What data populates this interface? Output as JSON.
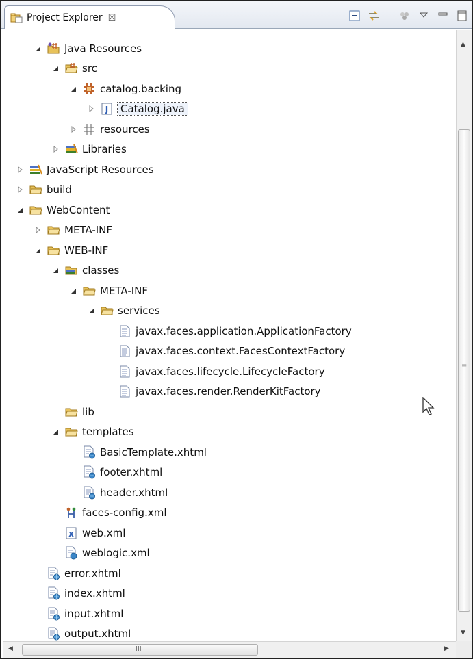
{
  "panel": {
    "tab_label": "Project Explorer",
    "tab_close": "☒"
  },
  "toolbar": {
    "items": [
      "collapse-all",
      "link-with-editor",
      "select-working-set",
      "view-menu",
      "minimize",
      "maximize"
    ]
  },
  "tree": [
    {
      "label": "Java Resources",
      "icon": "java-resources-icon",
      "level": 2,
      "expanded": true
    },
    {
      "label": "src",
      "icon": "source-folder-icon",
      "level": 3,
      "expanded": true
    },
    {
      "label": "catalog.backing",
      "icon": "package-icon",
      "level": 4,
      "expanded": true
    },
    {
      "label": "Catalog.java",
      "icon": "java-file-icon",
      "level": 5,
      "expanded": false,
      "selected": true
    },
    {
      "label": "resources",
      "icon": "empty-package-icon",
      "level": 4,
      "expanded": false
    },
    {
      "label": "Libraries",
      "icon": "library-icon",
      "level": 3,
      "expanded": false
    },
    {
      "label": "JavaScript Resources",
      "icon": "library-icon",
      "level": 1,
      "expanded": false
    },
    {
      "label": "build",
      "icon": "folder-icon",
      "level": 1,
      "expanded": false
    },
    {
      "label": "WebContent",
      "icon": "folder-icon",
      "level": 1,
      "expanded": true
    },
    {
      "label": "META-INF",
      "icon": "folder-icon",
      "level": 2,
      "expanded": false
    },
    {
      "label": "WEB-INF",
      "icon": "folder-icon",
      "level": 2,
      "expanded": true
    },
    {
      "label": "classes",
      "icon": "classes-folder-icon",
      "level": 3,
      "expanded": true
    },
    {
      "label": "META-INF",
      "icon": "folder-icon",
      "level": 4,
      "expanded": true
    },
    {
      "label": "services",
      "icon": "folder-icon",
      "level": 5,
      "expanded": true
    },
    {
      "label": "javax.faces.application.ApplicationFactory",
      "icon": "text-file-icon",
      "level": 6
    },
    {
      "label": "javax.faces.context.FacesContextFactory",
      "icon": "text-file-icon",
      "level": 6
    },
    {
      "label": "javax.faces.lifecycle.LifecycleFactory",
      "icon": "text-file-icon",
      "level": 6
    },
    {
      "label": "javax.faces.render.RenderKitFactory",
      "icon": "text-file-icon",
      "level": 6
    },
    {
      "label": "lib",
      "icon": "folder-icon",
      "level": 3
    },
    {
      "label": "templates",
      "icon": "folder-icon",
      "level": 3,
      "expanded": true
    },
    {
      "label": "BasicTemplate.xhtml",
      "icon": "xhtml-file-icon",
      "level": 4
    },
    {
      "label": "footer.xhtml",
      "icon": "xhtml-file-icon",
      "level": 4
    },
    {
      "label": "header.xhtml",
      "icon": "xhtml-file-icon",
      "level": 4
    },
    {
      "label": "faces-config.xml",
      "icon": "faces-config-icon",
      "level": 3
    },
    {
      "label": "web.xml",
      "icon": "xml-file-icon",
      "level": 3
    },
    {
      "label": "weblogic.xml",
      "icon": "weblogic-xml-icon",
      "level": 3
    },
    {
      "label": "error.xhtml",
      "icon": "xhtml-file-icon",
      "level": 2
    },
    {
      "label": "index.xhtml",
      "icon": "xhtml-file-icon",
      "level": 2
    },
    {
      "label": "input.xhtml",
      "icon": "xhtml-file-icon",
      "level": 2
    },
    {
      "label": "output.xhtml",
      "icon": "xhtml-file-icon",
      "level": 2
    }
  ],
  "scrollbars": {
    "vertical_grip": "≡",
    "horizontal_grip": "III",
    "up_arrow": "▲",
    "down_arrow": "▼",
    "left_arrow": "◀",
    "right_arrow": "▶"
  },
  "colors": {
    "folder": "#e8c25a",
    "package": "#c0632b",
    "library": "#3d7f2a",
    "java": "#2f5fb5"
  }
}
